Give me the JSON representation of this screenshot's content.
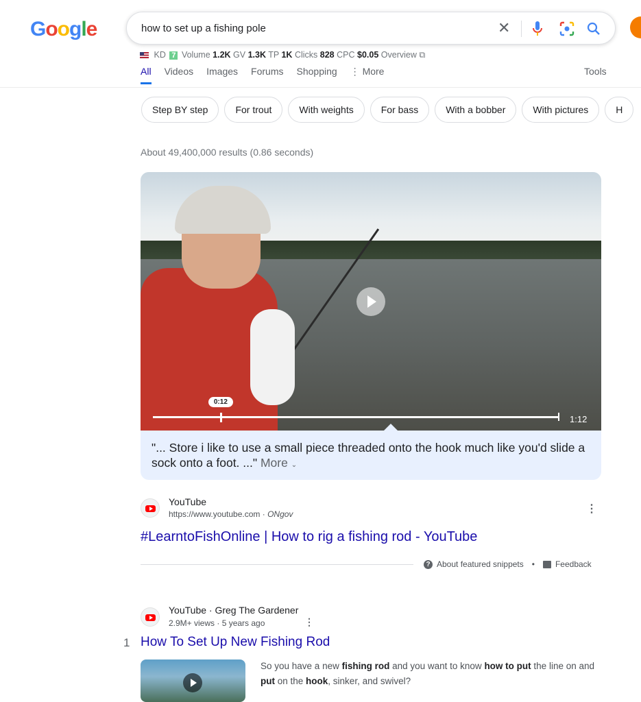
{
  "logo": {
    "letters": [
      "G",
      "o",
      "o",
      "g",
      "l",
      "e"
    ]
  },
  "search": {
    "query": "how to set up a fishing pole"
  },
  "kd": {
    "kd_label": "KD",
    "kd_value": "7",
    "volume_label": "Volume",
    "volume_value": "1.2K",
    "gv_label": "GV",
    "gv_value": "1.3K",
    "tp_label": "TP",
    "tp_value": "1K",
    "clicks_label": "Clicks",
    "clicks_value": "828",
    "cpc_label": "CPC",
    "cpc_value": "$0.05",
    "overview_label": "Overview"
  },
  "tabs": [
    {
      "label": "All",
      "active": true
    },
    {
      "label": "Videos"
    },
    {
      "label": "Images"
    },
    {
      "label": "Forums"
    },
    {
      "label": "Shopping"
    },
    {
      "label": "More"
    }
  ],
  "tools_label": "Tools",
  "chips": [
    "Step BY step",
    "For trout",
    "With weights",
    "For bass",
    "With a bobber",
    "With pictures",
    "H"
  ],
  "stats": "About 49,400,000 results (0.86 seconds)",
  "featured": {
    "current_time": "0:12",
    "duration": "1:12",
    "progress": 0.167,
    "quote": "\"... Store i like to use a small piece threaded onto the hook much like you'd slide a sock onto a foot. ...\"",
    "more_label": "More",
    "source_name": "YouTube",
    "source_url": "https://www.youtube.com",
    "source_author": "ONgov",
    "title": "#LearntoFishOnline | How to rig a fishing rod - YouTube",
    "about_label": "About featured snippets",
    "feedback_label": "Feedback"
  },
  "result2": {
    "rank": "1",
    "source_line": "YouTube · Greg The Gardener",
    "meta": "2.9M+ views · 5 years ago",
    "title": "How To Set Up New Fishing Rod",
    "snippet_parts": [
      {
        "text": "So you have a new ",
        "bold": false
      },
      {
        "text": "fishing rod",
        "bold": true
      },
      {
        "text": " and you want to know ",
        "bold": false
      },
      {
        "text": "how to put",
        "bold": true
      },
      {
        "text": " the line on and ",
        "bold": false
      },
      {
        "text": "put",
        "bold": true
      },
      {
        "text": " on the ",
        "bold": false
      },
      {
        "text": "hook",
        "bold": true
      },
      {
        "text": ", sinker, and swivel?",
        "bold": false
      }
    ]
  },
  "colors": {
    "link": "#1a0dab",
    "accent": "#1a73e8",
    "kd_badge": "#6dcf8f"
  }
}
